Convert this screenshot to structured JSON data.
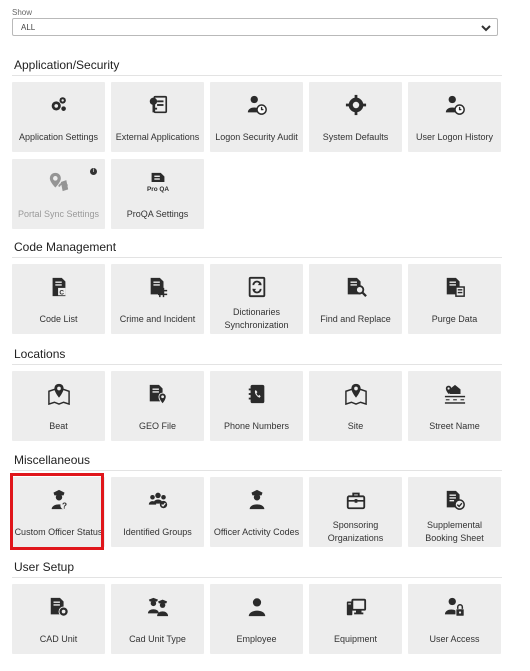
{
  "filter": {
    "label": "Show",
    "value": "ALL"
  },
  "sections": [
    {
      "title": "Application/Security",
      "items": [
        {
          "label": "Application Settings",
          "icon": "gears-icon"
        },
        {
          "label": "External Applications",
          "icon": "external-apps-icon"
        },
        {
          "label": "Logon Security Audit",
          "icon": "user-clock-icon"
        },
        {
          "label": "System Defaults",
          "icon": "gear-icon"
        },
        {
          "label": "User Logon History",
          "icon": "user-clock-icon"
        },
        {
          "label": "Portal Sync Settings",
          "icon": "map-sync-icon",
          "disabled": true,
          "info": "i"
        },
        {
          "label": "ProQA Settings",
          "icon": "proqa-icon",
          "icon_text": "Pro QA"
        }
      ]
    },
    {
      "title": "Code Management",
      "items": [
        {
          "label": "Code List",
          "icon": "code-list-icon"
        },
        {
          "label": "Crime and Incident",
          "icon": "crime-incident-icon"
        },
        {
          "label": "Dictionaries Synchronization",
          "icon": "dictionary-sync-icon"
        },
        {
          "label": "Find and Replace",
          "icon": "find-replace-icon"
        },
        {
          "label": "Purge Data",
          "icon": "purge-data-icon"
        }
      ]
    },
    {
      "title": "Locations",
      "items": [
        {
          "label": "Beat",
          "icon": "map-pin-icon"
        },
        {
          "label": "GEO File",
          "icon": "geo-file-icon"
        },
        {
          "label": "Phone Numbers",
          "icon": "phone-book-icon"
        },
        {
          "label": "Site",
          "icon": "map-pin-icon"
        },
        {
          "label": "Street Name",
          "icon": "street-icon"
        }
      ]
    },
    {
      "title": "Miscellaneous",
      "items": [
        {
          "label": "Custom Officer Status",
          "icon": "officer-question-icon"
        },
        {
          "label": "Identified Groups",
          "icon": "group-check-icon"
        },
        {
          "label": "Officer Activity Codes",
          "icon": "officer-icon"
        },
        {
          "label": "Sponsoring Organizations",
          "icon": "briefcase-icon"
        },
        {
          "label": "Supplemental Booking Sheet",
          "icon": "booking-sheet-icon"
        }
      ]
    },
    {
      "title": "User Setup",
      "items": [
        {
          "label": "CAD Unit",
          "icon": "cad-unit-icon"
        },
        {
          "label": "Cad Unit Type",
          "icon": "officers-icon"
        },
        {
          "label": "Employee",
          "icon": "user-icon"
        },
        {
          "label": "Equipment",
          "icon": "equipment-icon"
        },
        {
          "label": "User Access",
          "icon": "user-lock-icon"
        }
      ]
    }
  ],
  "highlighted_item": "Custom Officer Status",
  "colors": {
    "tile_bg": "#ededed",
    "icon": "#2b2b2b",
    "highlight": "#e0161b",
    "disabled_text": "#9a9a9a"
  }
}
